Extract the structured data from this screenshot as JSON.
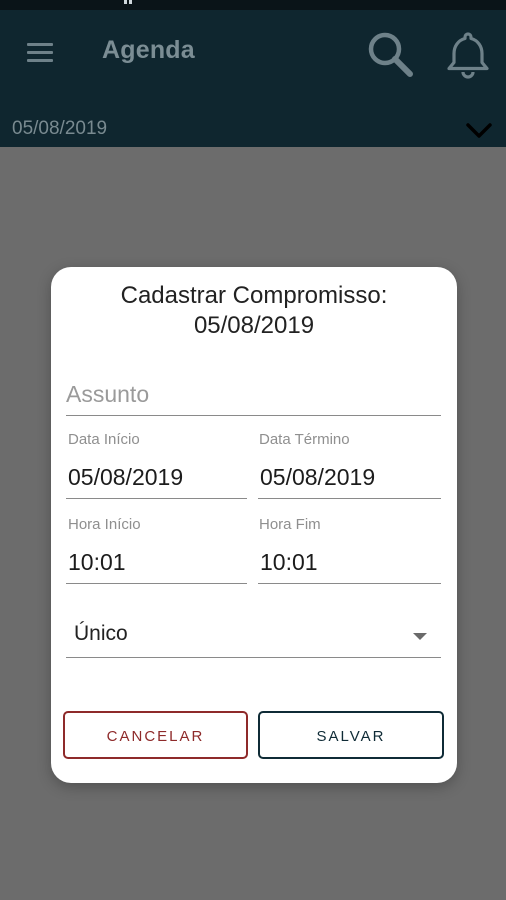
{
  "app": {
    "title": "Agenda",
    "icons": {
      "menu": "menu-icon",
      "search": "search-icon",
      "notifications": "bell-icon",
      "date_toggle": "chevron-down-icon"
    },
    "selected_date": "05/08/2019"
  },
  "dialog": {
    "title_line1": "Cadastrar Compromisso:",
    "title_line2": "05/08/2019",
    "subject_placeholder": "Assunto",
    "start_date_label": "Data Início",
    "start_date_value": "05/08/2019",
    "end_date_label": "Data Término",
    "end_date_value": "05/08/2019",
    "start_time_label": "Hora Início",
    "start_time_value": "10:01",
    "end_time_label": "Hora Fim",
    "end_time_value": "10:01",
    "recurrence_value": "Único",
    "cancel_label": "CANCELAR",
    "save_label": "SALVAR"
  },
  "colors": {
    "appbar": "#0f262f",
    "overlay": "#6c6c6c",
    "cancel": "#8e2a2a",
    "save": "#0f2b36"
  }
}
